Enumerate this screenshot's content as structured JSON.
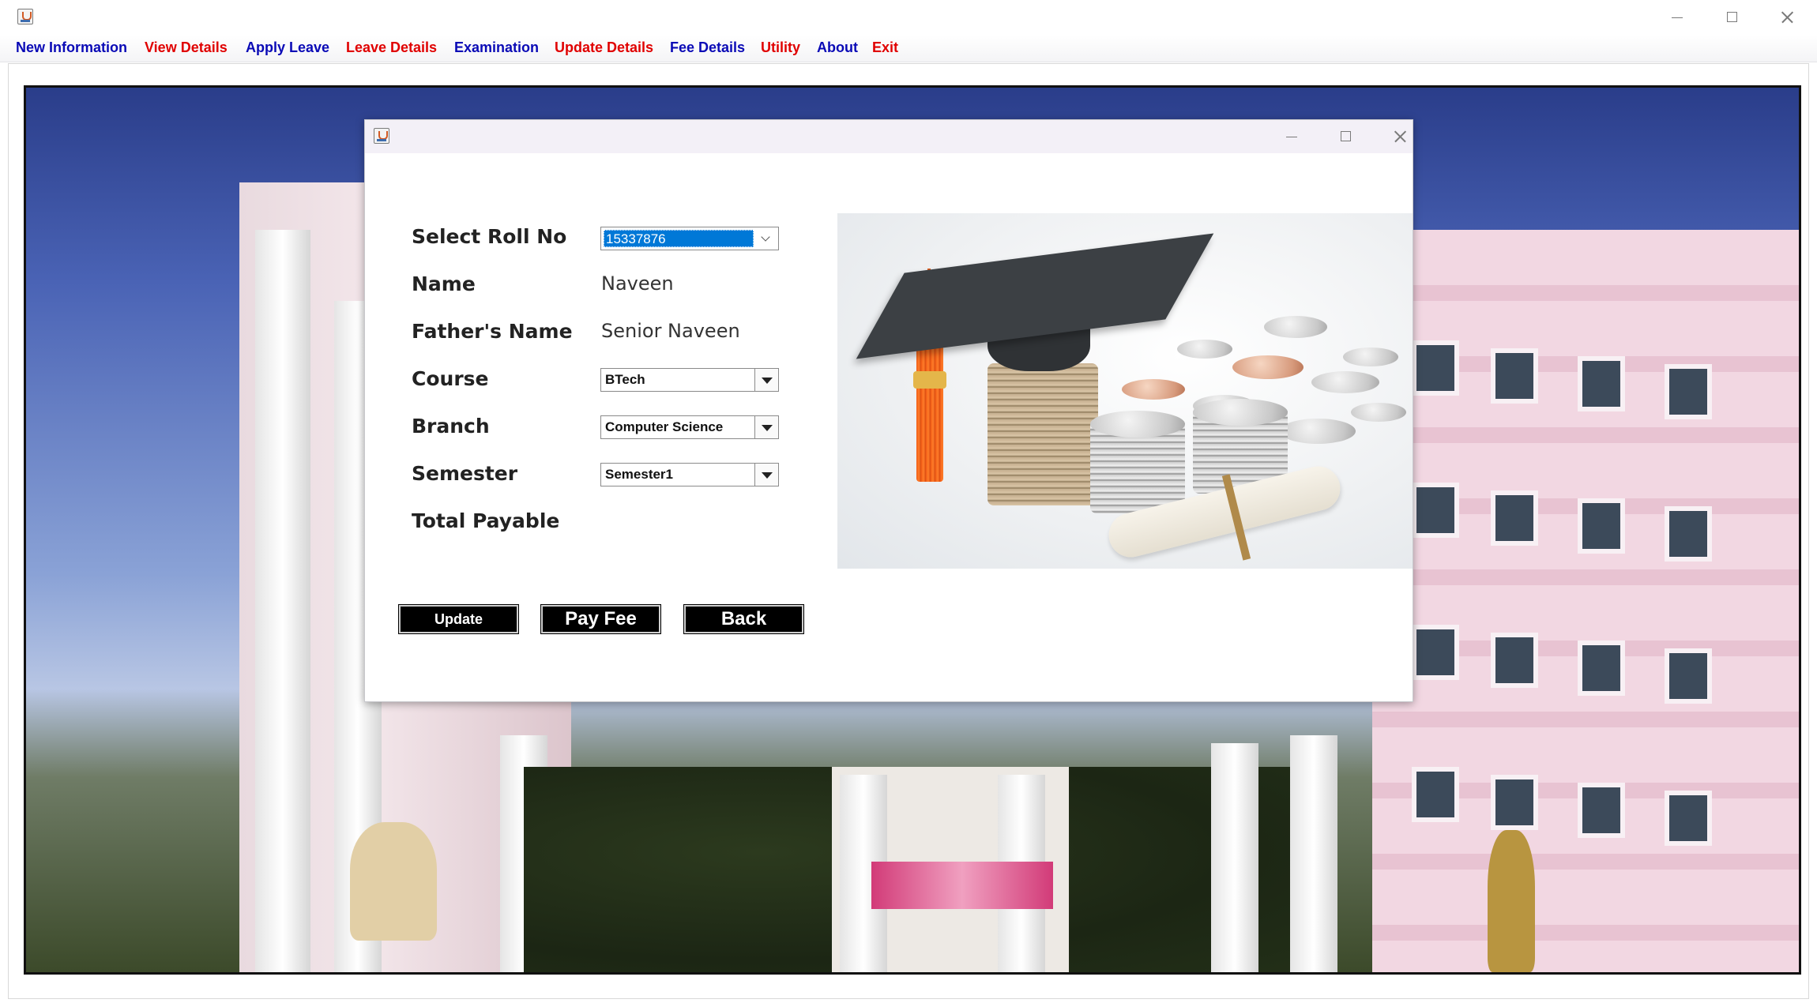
{
  "main_window": {
    "menu": [
      {
        "label": "New Information",
        "color": "#0a0ab6"
      },
      {
        "label": "View Details",
        "color": "#e00000"
      },
      {
        "label": "Apply Leave",
        "color": "#0a0ab6"
      },
      {
        "label": "Leave Details",
        "color": "#e00000"
      },
      {
        "label": "Examination",
        "color": "#0a0ab6"
      },
      {
        "label": "Update Details",
        "color": "#e00000"
      },
      {
        "label": "Fee Details",
        "color": "#0a0ab6"
      },
      {
        "label": "Utility",
        "color": "#e00000"
      },
      {
        "label": "About",
        "color": "#0a0ab6"
      },
      {
        "label": "Exit",
        "color": "#e00000"
      }
    ],
    "controls": [
      "minimize-icon",
      "maximize-icon",
      "close-icon"
    ]
  },
  "fee_dialog": {
    "controls": [
      "minimize-icon",
      "maximize-icon",
      "close-icon"
    ],
    "form": {
      "roll_no_label": "Select Roll No",
      "roll_no_value": "15337876",
      "name_label": "Name",
      "name_value": "Naveen",
      "father_label": "Father's Name",
      "father_value": "Senior Naveen",
      "course_label": "Course",
      "course_value": "BTech",
      "branch_label": "Branch",
      "branch_value": "Computer Science",
      "semester_label": "Semester",
      "semester_value": "Semester1",
      "total_label": "Total Payable",
      "total_value": ""
    },
    "buttons": {
      "update": "Update",
      "pay_fee": "Pay Fee",
      "back": "Back"
    },
    "image": "graduation-cap-with-coins"
  },
  "background": "college-campus-photo",
  "colors": {
    "menu_blue": "#0a0ab6",
    "menu_red": "#e00000",
    "button_bg": "#000000",
    "button_text": "#ffffff",
    "selection": "#0078d7"
  }
}
